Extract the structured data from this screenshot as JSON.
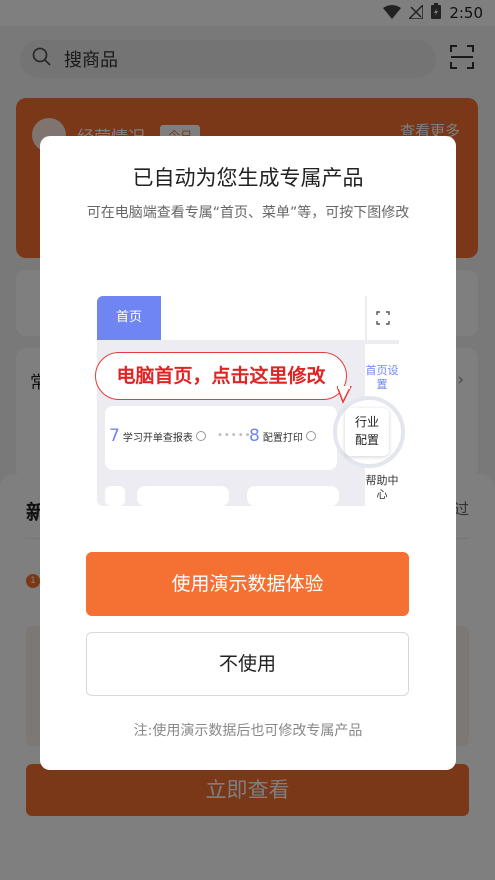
{
  "status_bar": {
    "time": "2:50"
  },
  "background": {
    "search": {
      "placeholder": "搜商品"
    },
    "business_card": {
      "title": "经营情况",
      "period": "今日",
      "more": "查看更多"
    },
    "section_card": {
      "title": "常"
    },
    "sheet": {
      "title": "新",
      "skip": "过",
      "step_number": "1"
    },
    "view_button": "立即查看"
  },
  "dialog": {
    "title": "已自动为您生成专属产品",
    "subtitle": "可在电脑端查看专属“首页、菜单”等，可按下图修改",
    "illustration": {
      "home_tab": "首页",
      "callout": "电脑首页，点击这里修改",
      "side_menu": [
        "首页设置",
        "行业配置",
        "帮助中心"
      ],
      "steps": [
        {
          "num": "7",
          "label": "学习开单查报表"
        },
        {
          "num": "8",
          "label": "配置打印"
        }
      ]
    },
    "primary_button": "使用演示数据体验",
    "secondary_button": "不使用",
    "note": "注:使用演示数据后也可修改专属产品"
  },
  "colors": {
    "accent": "#f57033",
    "illustration_blue": "#6f86f2",
    "callout_red": "#e02424"
  }
}
